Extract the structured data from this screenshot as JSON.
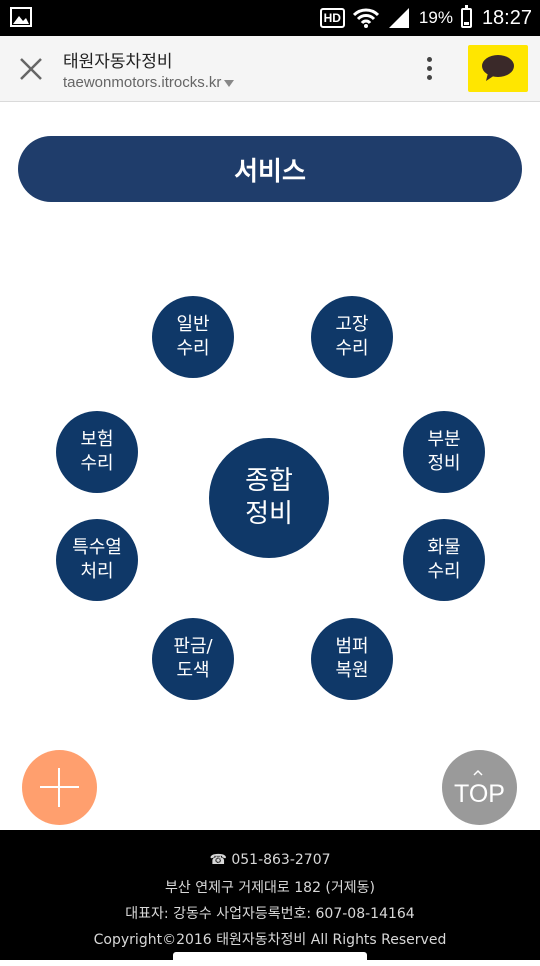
{
  "status_bar": {
    "hd": "HD",
    "battery_percent": "19%",
    "time": "18:27",
    "battery_level": 0.19,
    "icons": [
      "gallery-icon",
      "wifi-icon",
      "signal-icon",
      "battery-icon"
    ]
  },
  "browser": {
    "title": "태원자동차정비",
    "url": "taewonmotors.itrocks.kr",
    "kakao_color": "#ffe600"
  },
  "section": {
    "title": "서비스"
  },
  "services": {
    "center": [
      "종합",
      "정비"
    ],
    "general": [
      "일반",
      "수리"
    ],
    "fault": [
      "고장",
      "수리"
    ],
    "insurance": [
      "보험",
      "수리"
    ],
    "partial": [
      "부분",
      "정비"
    ],
    "special": [
      "특수열",
      "처리"
    ],
    "cargo": [
      "화물",
      "수리"
    ],
    "body": [
      "판금/",
      "도색"
    ],
    "bumper": [
      "범퍼",
      "복원"
    ]
  },
  "fab": {
    "top_label": "TOP",
    "plus_color": "#ff9f6e"
  },
  "footer": {
    "phone": "☎ 051-863-2707",
    "address": "부산 연제구 거제대로 182 (거제동)",
    "owner": "대표자: 강동수 사업자등록번호: 607-08-14164",
    "copyright": "Copyright©2016 태원자동차정비 All Rights Reserved"
  },
  "colors": {
    "primary": "#1f3d6b",
    "circle": "#0f3868"
  }
}
